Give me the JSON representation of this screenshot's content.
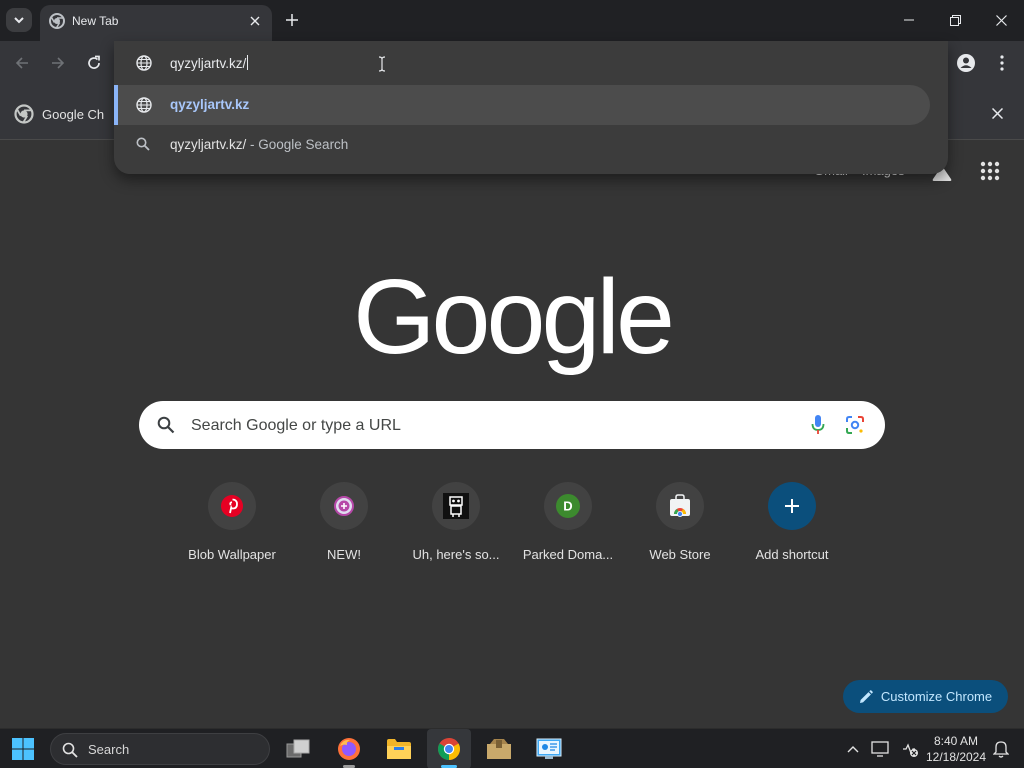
{
  "browser": {
    "tab_title": "New Tab",
    "bookmark_label": "Google Ch",
    "omnibox": {
      "input": "qyzyljartv.kz/",
      "suggestions": [
        {
          "text": "qyzyljartv.kz",
          "suffix": "",
          "type": "url"
        },
        {
          "text": "qyzyljartv.kz/",
          "suffix": " - Google Search",
          "type": "search"
        }
      ]
    }
  },
  "ntp": {
    "top_links": [
      "Gmail",
      "Images"
    ],
    "logo": "Google",
    "search_placeholder": "Search Google or type a URL",
    "shortcuts": [
      {
        "label": "Blob Wallpaper",
        "icon": "pinterest-icon"
      },
      {
        "label": "NEW!",
        "icon": "plus-badge-icon"
      },
      {
        "label": "Uh, here's so...",
        "icon": "robot-icon"
      },
      {
        "label": "Parked Doma...",
        "icon": "letter-d-icon",
        "letter": "D"
      },
      {
        "label": "Web Store",
        "icon": "web-store-icon"
      },
      {
        "label": "Add shortcut",
        "icon": "plus-icon"
      }
    ],
    "customize_label": "Customize Chrome"
  },
  "taskbar": {
    "search_label": "Search",
    "apps": [
      "task-view",
      "firefox",
      "file-explorer",
      "chrome",
      "archive",
      "control-panel"
    ],
    "time": "8:40 AM",
    "date": "12/18/2024"
  },
  "colors": {
    "accent": "#8ab4f8",
    "customize_bg": "#0b4f7c",
    "page_bg": "#353535",
    "titlebar_bg": "#202124",
    "taskbar_active": "#4cc2ff"
  }
}
